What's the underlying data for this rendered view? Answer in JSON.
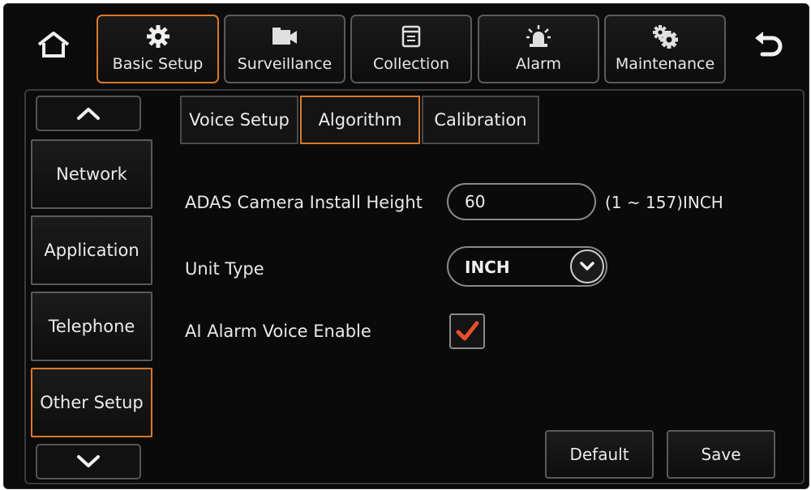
{
  "colors": {
    "accent": "#d9792a",
    "check": "#e8502a",
    "background": "#0b0b0b",
    "text": "#e8e8e8"
  },
  "top_nav": {
    "home_icon": "home-icon",
    "back_icon": "back-arrow-icon",
    "tabs": [
      {
        "label": "Basic Setup",
        "icon": "gear-icon",
        "active": true
      },
      {
        "label": "Surveillance",
        "icon": "video-camera-icon",
        "active": false
      },
      {
        "label": "Collection",
        "icon": "document-icon",
        "active": false
      },
      {
        "label": "Alarm",
        "icon": "alarm-light-icon",
        "active": false
      },
      {
        "label": "Maintenance",
        "icon": "gears-icon",
        "active": false
      }
    ]
  },
  "sidebar": {
    "scroll_up_icon": "chevron-up-icon",
    "scroll_down_icon": "chevron-down-icon",
    "items": [
      {
        "label": "Network",
        "active": false
      },
      {
        "label": "Application",
        "active": false
      },
      {
        "label": "Telephone",
        "active": false
      },
      {
        "label": "Other Setup",
        "active": true
      }
    ]
  },
  "sub_tabs": [
    {
      "label": "Voice Setup",
      "active": false
    },
    {
      "label": "Algorithm",
      "active": true
    },
    {
      "label": "Calibration",
      "active": false
    }
  ],
  "form": {
    "install_height": {
      "label": "ADAS Camera Install Height",
      "value": "60",
      "range": "(1 ~ 157)INCH"
    },
    "unit_type": {
      "label": "Unit Type",
      "value": "INCH"
    },
    "ai_alarm_voice": {
      "label": "AI Alarm Voice Enable",
      "checked": true
    }
  },
  "actions": {
    "default_label": "Default",
    "save_label": "Save"
  }
}
